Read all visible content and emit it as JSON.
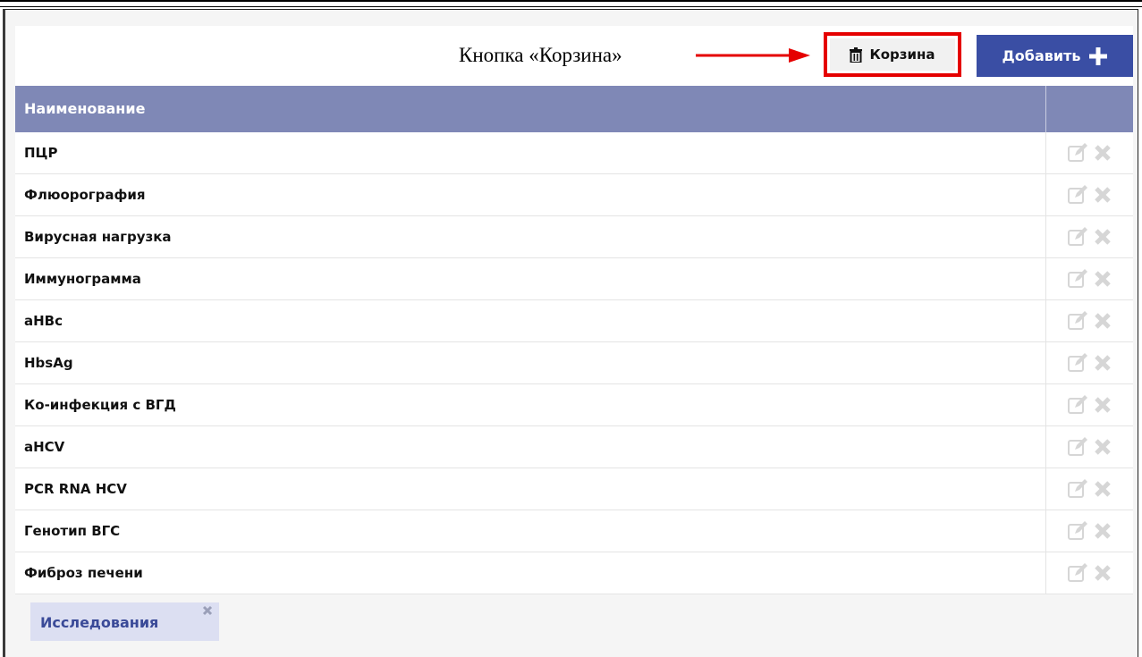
{
  "annotation": {
    "text": "Кнопка «Корзина»",
    "arrow_color": "#e50000"
  },
  "toolbar": {
    "trash_label": "Корзина",
    "trash_icon": "trash-icon",
    "add_label": "Добавить",
    "add_icon": "plus-icon",
    "add_color": "#3a4ea4",
    "highlight_color": "#e50000"
  },
  "table": {
    "header": {
      "name": "Наименование"
    },
    "header_color": "#7f88b6",
    "row_actions": [
      "edit-icon",
      "delete-icon"
    ],
    "rows": [
      {
        "name": "ПЦР"
      },
      {
        "name": "Флюорография"
      },
      {
        "name": "Вирусная нагрузка"
      },
      {
        "name": "Иммунограмма"
      },
      {
        "name": "aHBc"
      },
      {
        "name": "HbsAg"
      },
      {
        "name": "Ко-инфекция с ВГД"
      },
      {
        "name": "aHCV"
      },
      {
        "name": "PCR RNA HCV"
      },
      {
        "name": "Генотип ВГС"
      },
      {
        "name": "Фиброз печени"
      }
    ]
  },
  "tabs": [
    {
      "label": "Исследования",
      "close_icon": "close-icon"
    }
  ]
}
